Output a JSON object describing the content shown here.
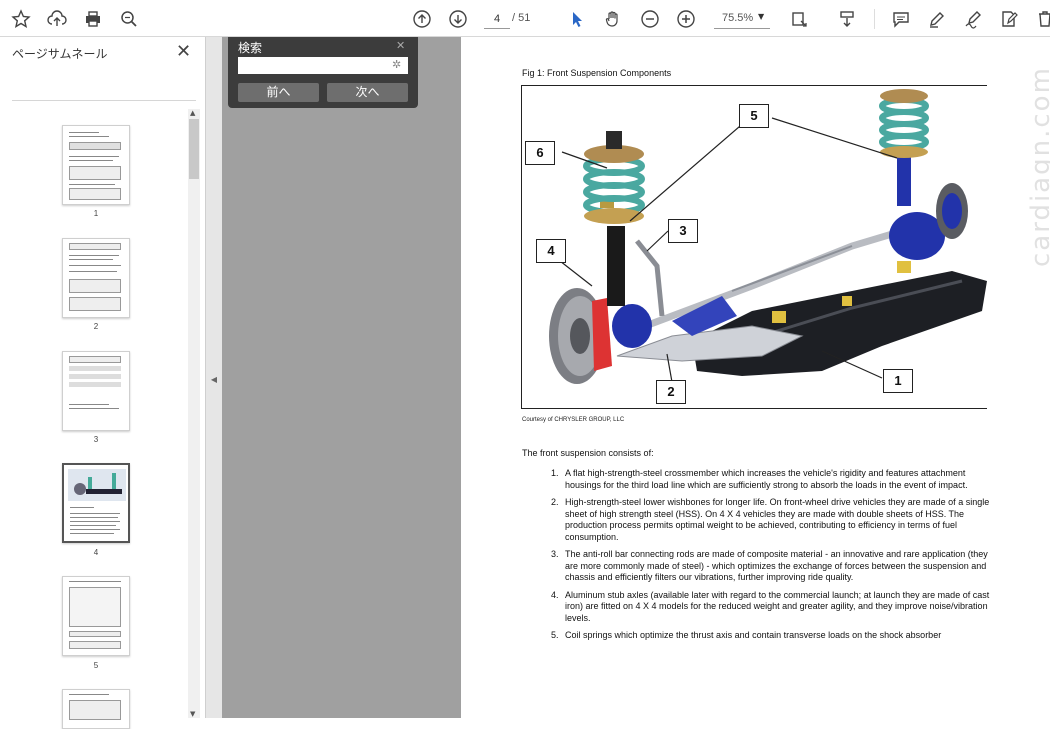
{
  "toolbar": {
    "page_current": "4",
    "page_total": "/ 51",
    "zoom": "75.5%"
  },
  "thumbnails": {
    "title": "ページサムネール",
    "pages": [
      "1",
      "2",
      "3",
      "4",
      "5"
    ]
  },
  "search": {
    "title": "検索",
    "input_value": "",
    "prev_label": "前へ",
    "next_label": "次へ"
  },
  "document": {
    "figure_caption": "Fig 1: Front Suspension Components",
    "courtesy": "Courtesy of CHRYSLER GROUP, LLC",
    "callouts": [
      "1",
      "2",
      "3",
      "4",
      "5",
      "6"
    ],
    "intro": "The front suspension consists of:",
    "items": [
      {
        "num": "1.",
        "text": "A flat high-strength-steel crossmember which increases the vehicle's rigidity and features attachment housings for the third load line which are sufficiently strong to absorb the loads in the event of impact."
      },
      {
        "num": "2.",
        "text": "High-strength-steel lower wishbones for longer life. On front-wheel drive vehicles they are made of a single sheet of high strength steel (HSS). On 4 X 4 vehicles they are made with double sheets of HSS. The production process permits optimal weight to be achieved, contributing to efficiency in terms of fuel consumption."
      },
      {
        "num": "3.",
        "text": "The anti-roll bar connecting rods are made of composite material - an innovative and rare application (they are more commonly made of steel) - which optimizes the exchange of forces between the suspension and chassis and efficiently filters our vibrations, further improving ride quality."
      },
      {
        "num": "4.",
        "text": "Aluminum stub axles (available later with regard to the commercial launch; at launch they are made of cast iron) are fitted on 4 X 4 models for the reduced weight and greater agility, and they improve noise/vibration levels."
      },
      {
        "num": "5.",
        "text": "Coil springs which optimize the thrust axis and contain transverse loads on the shock absorber"
      }
    ],
    "watermark": "cardiagn.com"
  }
}
